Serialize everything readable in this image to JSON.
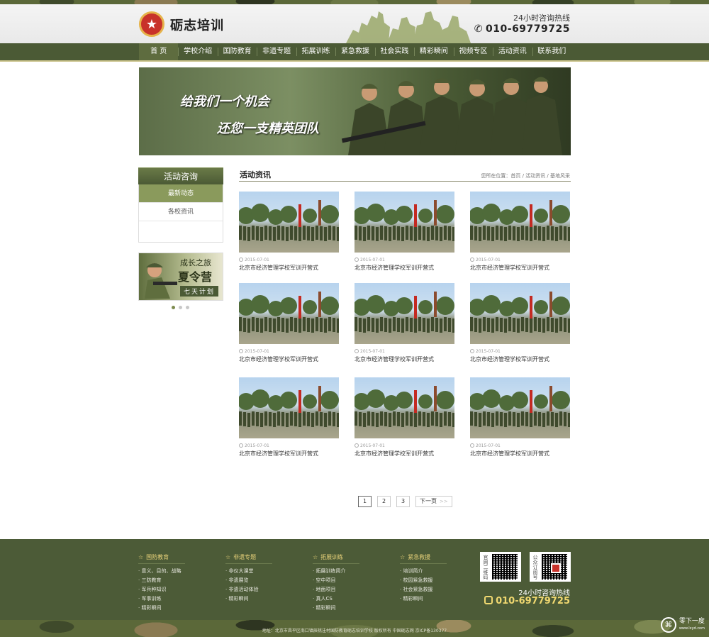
{
  "header": {
    "logo_text": "砺志培训",
    "hotline_label": "24小时咨询热线",
    "hotline_number": "010-69779725"
  },
  "nav": {
    "items": [
      "首 页",
      "学校介绍",
      "国防教育",
      "非遗专题",
      "拓展训练",
      "紧急救援",
      "社会实践",
      "精彩瞬间",
      "视频专区",
      "活动资讯",
      "联系我们"
    ]
  },
  "banner": {
    "line1": "给我们一个机会",
    "line2": "还您一支精英团队"
  },
  "sidebar": {
    "title": "活动咨询",
    "items": [
      "最新动态",
      "各校资讯"
    ],
    "ad": {
      "line1": "成长之旅",
      "line2": "夏令营",
      "line3": "七天计划"
    }
  },
  "main": {
    "title": "活动资讯",
    "breadcrumb": [
      "您所在位置：首页",
      "活动资讯",
      "基地风采"
    ],
    "cards": [
      {
        "date": "2015-07-01",
        "caption": "北京市经济管理学校军训开营式"
      },
      {
        "date": "2015-07-01",
        "caption": "北京市经济管理学校军训开营式"
      },
      {
        "date": "2015-07-01",
        "caption": "北京市经济管理学校军训开营式"
      },
      {
        "date": "2015-07-01",
        "caption": "北京市经济管理学校军训开营式"
      },
      {
        "date": "2015-07-01",
        "caption": "北京市经济管理学校军训开营式"
      },
      {
        "date": "2015-07-01",
        "caption": "北京市经济管理学校军训开营式"
      },
      {
        "date": "2015-07-01",
        "caption": "北京市经济管理学校军训开营式"
      },
      {
        "date": "2015-07-01",
        "caption": "北京市经济管理学校军训开营式"
      },
      {
        "date": "2015-07-01",
        "caption": "北京市经济管理学校军训开营式"
      }
    ]
  },
  "pager": {
    "pages": [
      "1",
      "2",
      "3"
    ],
    "next": "下一页",
    "next_arrow": ">>"
  },
  "footer": {
    "columns": [
      {
        "title": "国防教育",
        "links": [
          "意义、目的、战略",
          "三防教育",
          "军兵种知识",
          "军事训练",
          "精彩瞬间"
        ]
      },
      {
        "title": "非遗专题",
        "links": [
          "非仪大课堂",
          "非遗展览",
          "非遗活动体验",
          "精彩瞬间"
        ]
      },
      {
        "title": "拓展训练",
        "links": [
          "拓展训练简介",
          "空中项目",
          "地面项目",
          "真人CS",
          "精彩瞬间"
        ]
      },
      {
        "title": "紧急救援",
        "links": [
          "培训简介",
          "校园紧急救援",
          "社会紧急救援",
          "精彩瞬间"
        ]
      }
    ],
    "qr_labels": [
      "官网二维码",
      "公众订阅号"
    ],
    "hotline_label": "24小时咨询热线",
    "hotline_number": "010-69779725",
    "copyright": "地址：北京市昌平区南口镇辰桃洼村国防教育砺志培训学校  版权所有  中国砺志网 京ICP备130377"
  },
  "watermark": {
    "name": "零下一度",
    "url": "www.lxyd.com"
  },
  "colors": {
    "nav_bg": "#4b5a35",
    "accent": "#8a9a5c",
    "footer_bg": "#4c5b37",
    "hotline_gold": "#f0d870"
  }
}
